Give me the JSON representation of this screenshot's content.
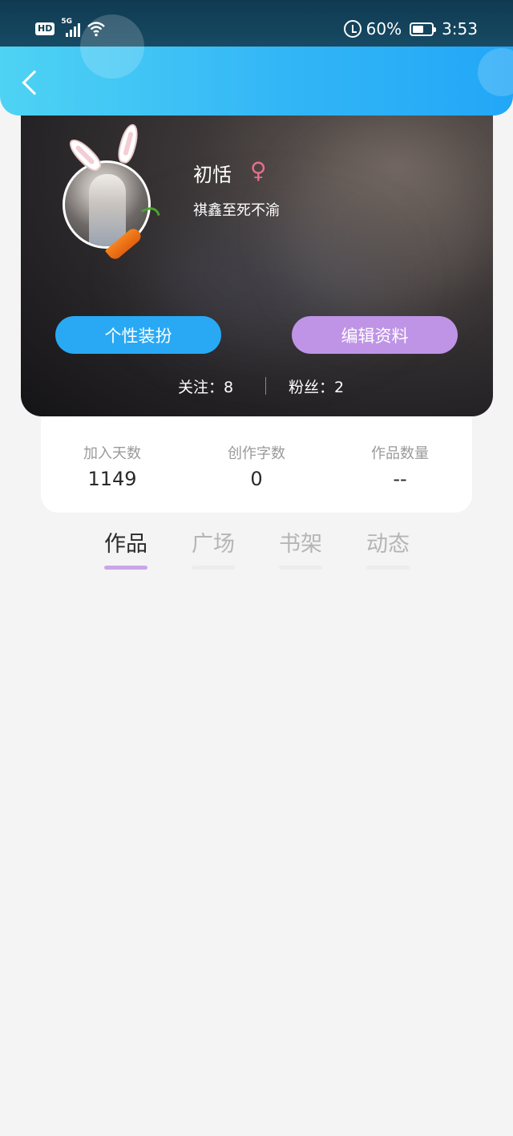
{
  "status_bar": {
    "hd": "HD",
    "network": "5G",
    "battery_percent": "60%",
    "battery_level": 0.6,
    "time": "3:53"
  },
  "header": {
    "back_icon": "chevron-left-icon"
  },
  "profile": {
    "nickname": "初恬",
    "gender_symbol": "♀",
    "gender_color": "#e66f8a",
    "signature": "祺鑫至死不渝",
    "buttons": {
      "style_label": "个性装扮",
      "edit_label": "编辑资料"
    },
    "following_text": "关注：8",
    "followers_text": "粉丝：2"
  },
  "stats": [
    {
      "label": "加入天数",
      "value": "1149"
    },
    {
      "label": "创作字数",
      "value": "0"
    },
    {
      "label": "作品数量",
      "value": "--"
    }
  ],
  "tabs": [
    {
      "label": "作品",
      "active": true
    },
    {
      "label": "广场",
      "active": false
    },
    {
      "label": "书架",
      "active": false
    },
    {
      "label": "动态",
      "active": false
    }
  ],
  "colors": {
    "header_accent": "#33b6f6",
    "style_button": "#29a9f4",
    "edit_button": "#bf94e6",
    "tab_indicator": "#c9a6ea"
  }
}
